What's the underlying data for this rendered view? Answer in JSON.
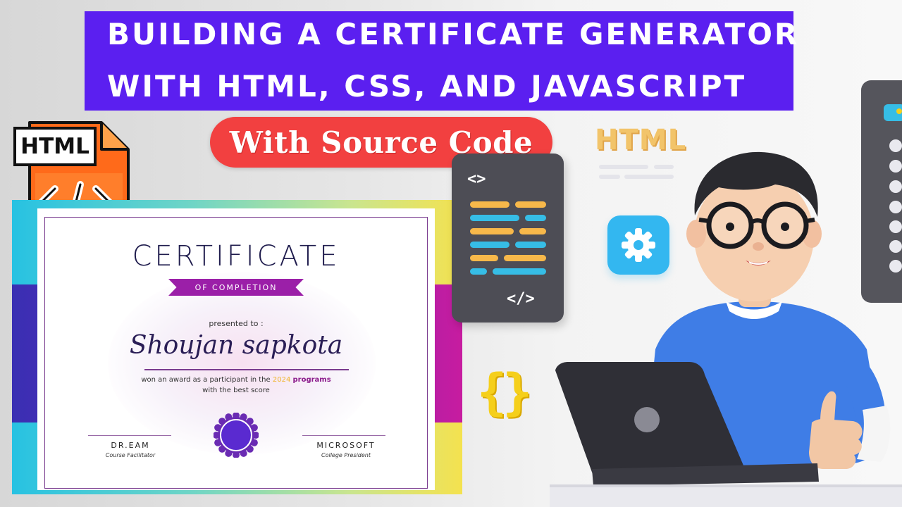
{
  "banner": {
    "line1": "BUILDING A CERTIFICATE GENERATOR",
    "line2": "WITH HTML, CSS, AND JAVASCRIPT"
  },
  "badge": {
    "label": "With Source Code"
  },
  "file_icon": {
    "tag": "HTML",
    "icon": "html-file-icon",
    "symbol": "</>"
  },
  "certificate": {
    "title": "CERTIFICATE",
    "subtitle": "OF COMPLETION",
    "presented": "presented to :",
    "name": "Shoujan sapkota",
    "desc_prefix": "won an award as a participant in the ",
    "desc_year": "2024",
    "desc_programs": "programs",
    "desc_line2": "with the best score",
    "left_signer": "DR.EAM",
    "left_role": "Course Facilitator",
    "right_signer": "MICROSOFT",
    "right_role": "College President",
    "seal_icon": "award-seal-icon"
  },
  "code_card": {
    "open_tag": "<>",
    "close_tag": "</>",
    "icon": "code-window-icon"
  },
  "floating": {
    "html_label": "HTML",
    "gear_icon": "gear-icon",
    "braces": "{}"
  },
  "colors": {
    "banner": "#5b1ff0",
    "pill": "#f24040",
    "accent_orange": "#f7b84a",
    "accent_blue": "#36bde6",
    "cert_purple": "#9b1fa8"
  }
}
